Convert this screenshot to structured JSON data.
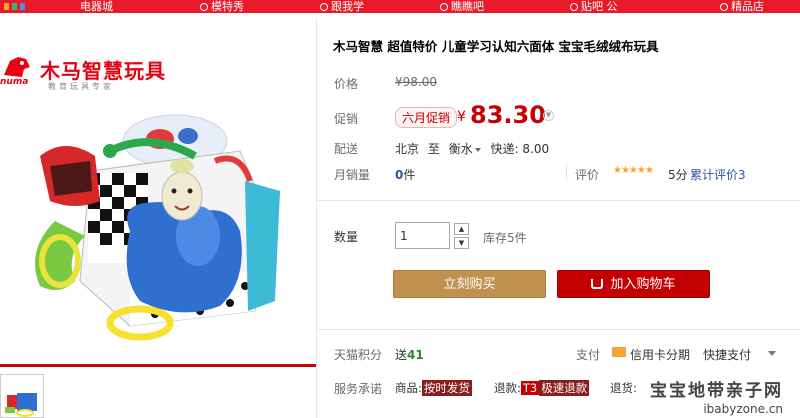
{
  "product": {
    "title": "木马智慧 超值特价 儿童学习认知六面体 宝宝毛绒绒布玩具",
    "logo_brand": "木马智慧玩具",
    "logo_tagline": "教育玩具专家",
    "logo_mark_text": "numa"
  },
  "labels": {
    "price": "价格",
    "promo": "促销",
    "shipping": "配送",
    "monthly_sales": "月销量",
    "reviews": "评价",
    "quantity": "数量",
    "points": "天猫积分",
    "pay": "支付",
    "service": "服务承诺"
  },
  "pricing": {
    "original": "¥98.00",
    "promo_badge": "六月促销",
    "currency": "¥",
    "current": "83.30"
  },
  "shipping": {
    "from": "北京",
    "to_word": "至",
    "dest": "衡水",
    "express": "快递: 8.00"
  },
  "sales": {
    "count": "0",
    "unit": "件"
  },
  "rating": {
    "stars": "★★★★★",
    "score": "5分",
    "total": "累计评价3"
  },
  "quantity": {
    "value": "1",
    "stock": "库存5件"
  },
  "buttons": {
    "buy_now": "立刻购买",
    "add_to_cart": "加入购物车"
  },
  "points": {
    "prefix": "送",
    "value": "41"
  },
  "payment": {
    "credit_installment": "信用卡分期",
    "quick_pay": "快捷支付"
  },
  "services": {
    "goods_prefix": "商品:",
    "goods_tag": "按时发货",
    "refund_prefix": "退款:",
    "refund_t3": "T3",
    "refund_tag": "极速退款",
    "return_prefix": "退货:"
  },
  "watermark": {
    "name": "宝宝地带亲子网",
    "url": "ibabyzone.cn"
  },
  "top_nav": {
    "items": [
      "电器城",
      "模特秀",
      "跟我学",
      "瞧瞧吧",
      "贴吧 公",
      "精品店"
    ]
  },
  "colors": {
    "brand_red": "#c40000",
    "buy_now": "#c0914f",
    "link_blue": "#2953a6",
    "points_green": "#228b22"
  }
}
